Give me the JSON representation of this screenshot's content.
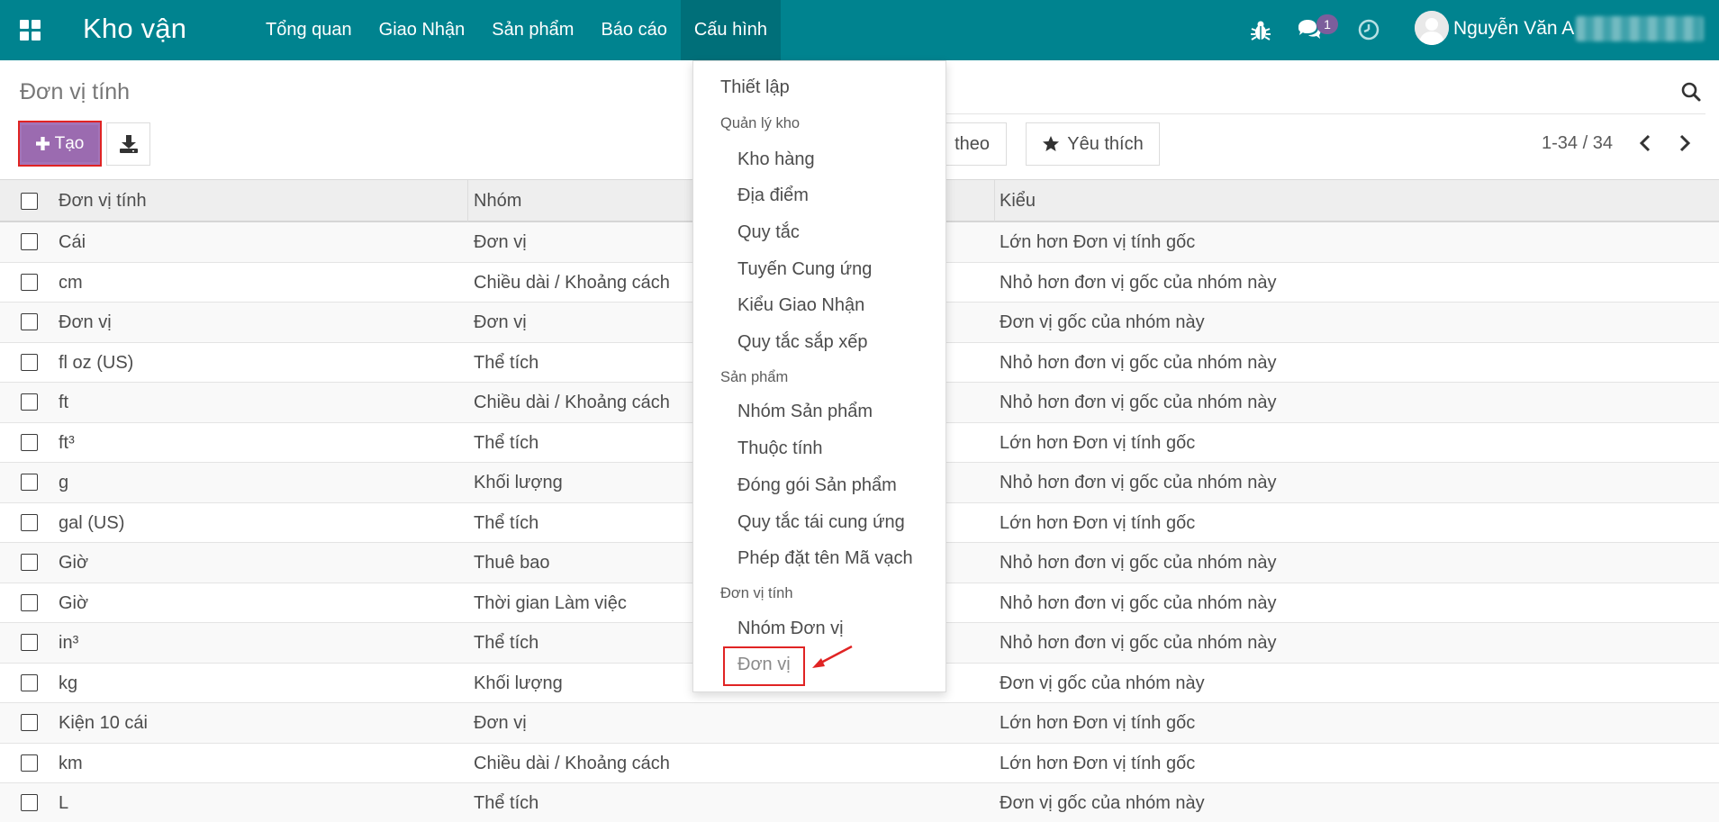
{
  "navbar": {
    "brand": "Kho vận",
    "menu": [
      "Tổng quan",
      "Giao Nhận",
      "Sản phẩm",
      "Báo cáo",
      "Cấu hình"
    ],
    "active_menu": "Cấu hình",
    "chat_badge": "1",
    "user_name": "Nguyễn Văn A",
    "color": "#00838f"
  },
  "control_panel": {
    "title": "Đơn vị tính",
    "create_label": "Tạo",
    "groupby_label": "theo",
    "favorites_label": "Yêu thích",
    "pager": "1-34 / 34"
  },
  "table": {
    "columns": [
      "Đơn vị tính",
      "Nhóm",
      "Kiểu"
    ],
    "rows": [
      {
        "name": "Cái",
        "group": "Đơn vị",
        "type": "Lớn hơn Đơn vị tính gốc"
      },
      {
        "name": "cm",
        "group": "Chiều dài / Khoảng cách",
        "type": "Nhỏ hơn đơn vị gốc của nhóm này"
      },
      {
        "name": "Đơn vị",
        "group": "Đơn vị",
        "type": "Đơn vị gốc của nhóm này"
      },
      {
        "name": "fl oz (US)",
        "group": "Thể tích",
        "type": "Nhỏ hơn đơn vị gốc của nhóm này"
      },
      {
        "name": "ft",
        "group": "Chiều dài / Khoảng cách",
        "type": "Nhỏ hơn đơn vị gốc của nhóm này"
      },
      {
        "name": "ft³",
        "group": "Thể tích",
        "type": "Lớn hơn Đơn vị tính gốc"
      },
      {
        "name": "g",
        "group": "Khối lượng",
        "type": "Nhỏ hơn đơn vị gốc của nhóm này"
      },
      {
        "name": "gal (US)",
        "group": "Thể tích",
        "type": "Lớn hơn Đơn vị tính gốc"
      },
      {
        "name": "Giờ",
        "group": "Thuê bao",
        "type": "Nhỏ hơn đơn vị gốc của nhóm này"
      },
      {
        "name": "Giờ",
        "group": "Thời gian Làm việc",
        "type": "Nhỏ hơn đơn vị gốc của nhóm này"
      },
      {
        "name": "in³",
        "group": "Thể tích",
        "type": "Nhỏ hơn đơn vị gốc của nhóm này"
      },
      {
        "name": "kg",
        "group": "Khối lượng",
        "type": "Đơn vị gốc của nhóm này"
      },
      {
        "name": "Kiện 10 cái",
        "group": "Đơn vị",
        "type": "Lớn hơn Đơn vị tính gốc"
      },
      {
        "name": "km",
        "group": "Chiều dài / Khoảng cách",
        "type": "Lớn hơn Đơn vị tính gốc"
      },
      {
        "name": "L",
        "group": "Thể tích",
        "type": "Đơn vị gốc của nhóm này"
      }
    ]
  },
  "dropdown": {
    "settings": "Thiết lập",
    "warehouse_header": "Quản lý kho",
    "warehouse_items": [
      "Kho hàng",
      "Địa điểm",
      "Quy tắc",
      "Tuyến Cung ứng",
      "Kiểu Giao Nhận",
      "Quy tắc sắp xếp"
    ],
    "product_header": "Sản phẩm",
    "product_items": [
      "Nhóm Sản phẩm",
      "Thuộc tính",
      "Đóng gói Sản phẩm",
      "Quy tắc tái cung ứng",
      "Phép đặt tên Mã vạch"
    ],
    "uom_header": "Đơn vị tính",
    "uom_items": [
      "Nhóm Đơn vị",
      "Đơn vị"
    ]
  },
  "icons": {
    "apps": "apps-grid-icon",
    "bug": "bug-icon",
    "chat": "chat-icon",
    "clock": "clock-icon",
    "search": "search-icon",
    "download": "download-icon",
    "star": "star-icon",
    "plus": "plus-icon"
  },
  "accent_colors": {
    "create_button": "#9b6bb0",
    "highlight_box": "#e02424"
  }
}
